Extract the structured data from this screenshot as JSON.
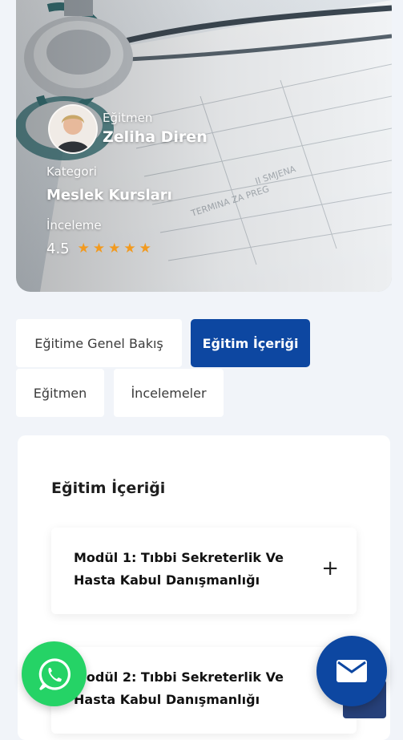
{
  "hero": {
    "instructor_label": "Eğitmen",
    "instructor_name": "Zeliha Diren",
    "category_label": "Kategori",
    "category_value": "Meslek Kursları",
    "review_label": "İnceleme",
    "rating_value": "4.5",
    "stars": 5,
    "star_color": "#f29a1f"
  },
  "tabs": [
    {
      "label": "Eğitime Genel Bakış",
      "active": false
    },
    {
      "label": "Eğitim İçeriği",
      "active": true
    },
    {
      "label": "Eğitmen",
      "active": false
    },
    {
      "label": "İncelemeler",
      "active": false
    }
  ],
  "content": {
    "title": "Eğitim İçeriği",
    "modules": [
      {
        "title": "Modül 1: Tıbbi Sekreterlik Ve Hasta Kabul Danışmanlığı",
        "icon": "plus-icon"
      },
      {
        "title": "Modül 2: Tıbbi Sekreterlik Ve Hasta Kabul Danışmanlığı",
        "icon": "plus-icon"
      }
    ]
  },
  "floating": {
    "whatsapp_icon": "whatsapp-icon",
    "whatsapp_color": "#25d366",
    "mail_icon": "mail-icon",
    "mail_color": "#0d47a1"
  },
  "colors": {
    "accent": "#0d47a1",
    "background": "#f1f4f9"
  }
}
